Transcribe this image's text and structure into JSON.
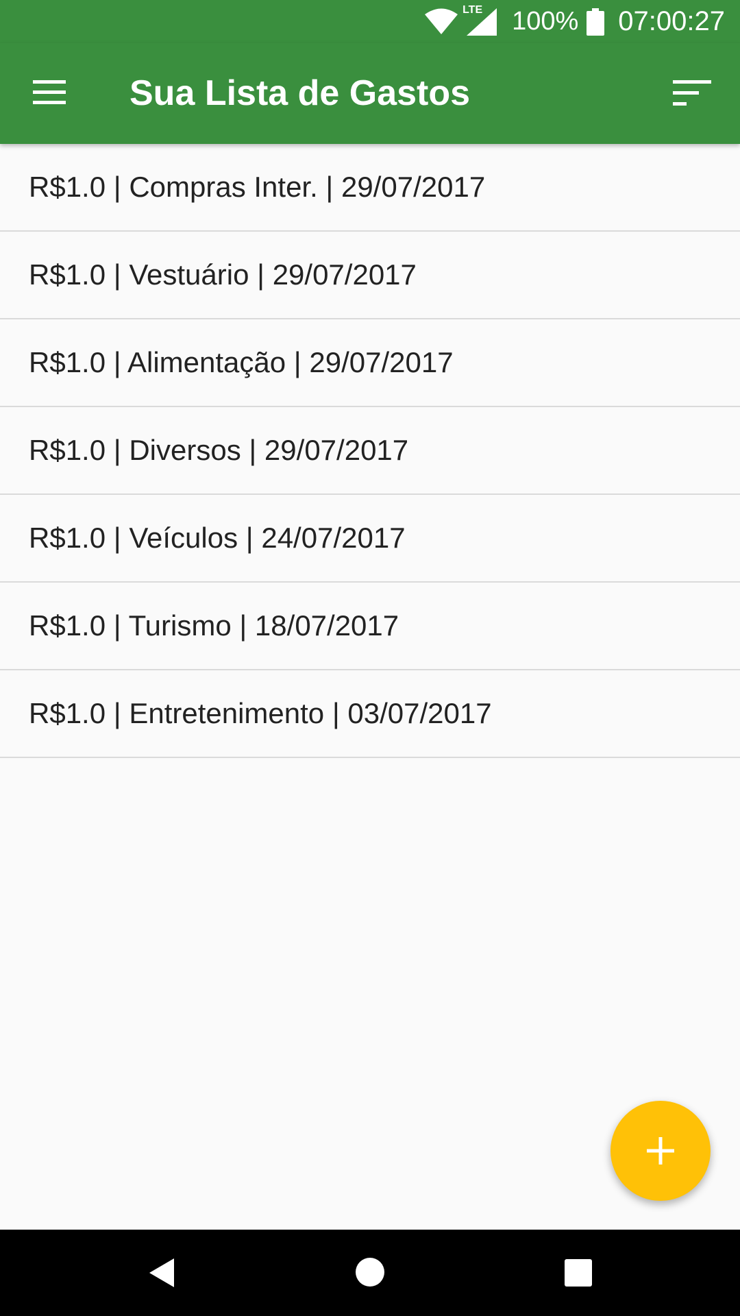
{
  "status_bar": {
    "network": "LTE",
    "battery": "100%",
    "time": "07:00:27",
    "icons": [
      "wifi-icon",
      "cell-signal-icon",
      "battery-icon"
    ]
  },
  "app_bar": {
    "title": "Sua Lista de Gastos",
    "menu_icon": "hamburger-menu-icon",
    "sort_icon": "sort-icon"
  },
  "expenses": [
    {
      "text": "R$1.0 | Compras Inter. | 29/07/2017"
    },
    {
      "text": "R$1.0 | Vestuário | 29/07/2017"
    },
    {
      "text": "R$1.0 | Alimentação | 29/07/2017"
    },
    {
      "text": "R$1.0 | Diversos | 29/07/2017"
    },
    {
      "text": "R$1.0 | Veículos | 24/07/2017"
    },
    {
      "text": "R$1.0 | Turismo | 18/07/2017"
    },
    {
      "text": "R$1.0 | Entretenimento | 03/07/2017"
    }
  ],
  "fab": {
    "icon": "plus-icon",
    "color": "#FFC107"
  },
  "colors": {
    "primary": "#3A8F3E",
    "accent": "#FFC107",
    "background": "#FAFAFA",
    "divider": "#DADADA"
  },
  "nav_bar": {
    "icons": [
      "back-icon",
      "home-icon",
      "recents-icon"
    ]
  }
}
